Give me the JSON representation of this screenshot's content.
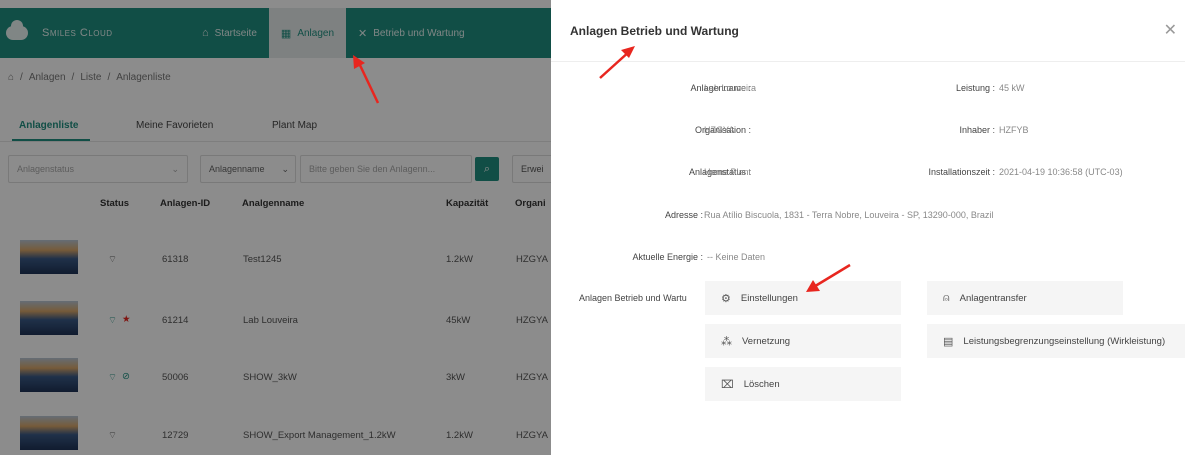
{
  "app": {
    "logo_text": "Smiles Cloud",
    "nav": [
      {
        "label": "Startseite",
        "icon": "home-icon",
        "glyph": "⌂"
      },
      {
        "label": "Anlagen",
        "icon": "building-icon",
        "glyph": "▦"
      },
      {
        "label": "Betrieb und Wartung",
        "icon": "tools-icon",
        "glyph": "✕"
      }
    ],
    "breadcrumb": [
      "Anlagen",
      "Liste",
      "Anlagenliste"
    ],
    "tabs": [
      "Anlagenliste",
      "Meine Favorieten",
      "Plant Map"
    ],
    "filters": {
      "status_placeholder": "Anlagenstatus",
      "name_select": "Anlagenname",
      "search_placeholder": "Bitte geben Sie den Anlagenn...",
      "extra_button": "Erwei"
    },
    "table": {
      "columns": [
        "Status",
        "Anlagen-ID",
        "Analgenname",
        "Kapazität",
        "Organi"
      ],
      "rows": [
        {
          "id": "61318",
          "name": "Test1245",
          "capacity": "1.2kW",
          "org": "HZGYA"
        },
        {
          "id": "61214",
          "name": "Lab Louveira",
          "capacity": "45kW",
          "org": "HZGYA"
        },
        {
          "id": "50006",
          "name": "SHOW_3kW",
          "capacity": "3kW",
          "org": "HZGYA"
        },
        {
          "id": "12729",
          "name": "SHOW_Export Management_1.2kW",
          "capacity": "1.2kW",
          "org": "HZGYA"
        }
      ]
    }
  },
  "drawer": {
    "title": "Anlagen Betrieb und Wartung",
    "fields": {
      "name_label": "Anlagenname :",
      "name_value": "Lab Louveira",
      "power_label": "Leistung :",
      "power_value": "45 kW",
      "org_label": "Organisation :",
      "org_value": "HZGYA",
      "owner_label": "Inhaber :",
      "owner_value": "HZFYB",
      "status_label": "Anlagenstatus :",
      "status_value": "Home Plant",
      "install_label": "Installationszeit :",
      "install_value": "2021-04-19 10:36:58 (UTC-03)",
      "address_label": "Adresse :",
      "address_value": "Rua Atílio Biscuola, 1831 - Terra Nobre, Louveira - SP, 13290-000, Brazil",
      "energy_label": "Aktuelle Energie :",
      "energy_value": "-- Keine Daten",
      "ops_label": "Anlagen Betrieb und Wartu"
    },
    "actions": [
      {
        "label": "Einstellungen",
        "icon": "gear-icon",
        "glyph": "⚙"
      },
      {
        "label": "Anlagentransfer",
        "icon": "user-icon",
        "glyph": "⍝"
      },
      {
        "label": "Vernetzung",
        "icon": "network-icon",
        "glyph": "⁂"
      },
      {
        "label": "Leistungsbegrenzungseinstellung (Wirkleistung)",
        "icon": "calendar-icon",
        "glyph": "▤"
      },
      {
        "label": "Löschen",
        "icon": "trash-icon",
        "glyph": "🗑"
      }
    ]
  },
  "colors": {
    "accent": "#1f8f80",
    "arrow": "#e8261f"
  }
}
